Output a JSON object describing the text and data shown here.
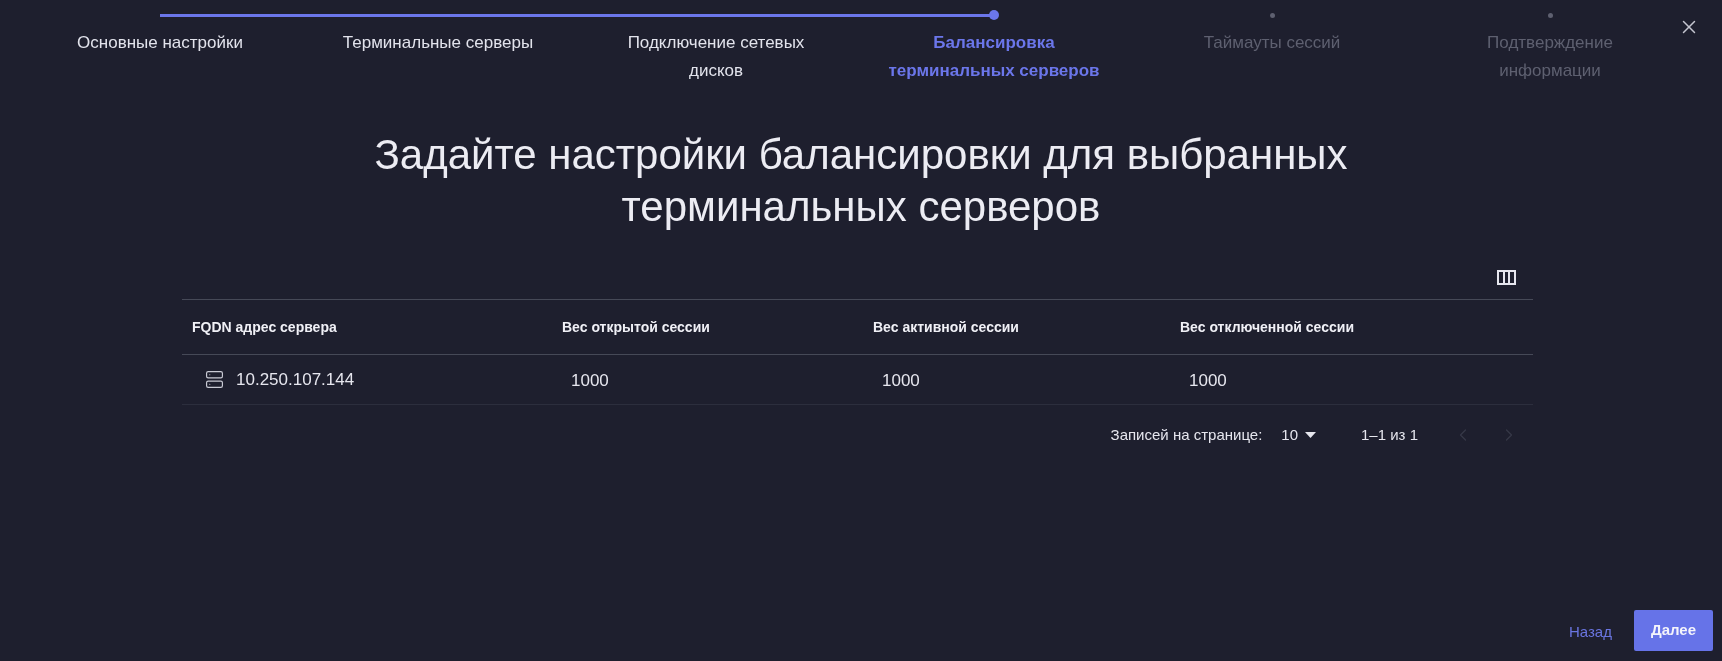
{
  "stepper": {
    "steps": [
      {
        "label": "Основные настройки",
        "completed": true,
        "selected": false
      },
      {
        "label": "Терминальные серверы",
        "completed": true,
        "selected": false
      },
      {
        "label": "Подключение сетевых дисков",
        "completed": true,
        "selected": false
      },
      {
        "label": "Балансировка терминальных серверов",
        "completed": false,
        "selected": true
      },
      {
        "label": "Таймауты сессий",
        "completed": false,
        "selected": false
      },
      {
        "label": "Подтверждение информации",
        "completed": false,
        "selected": false
      }
    ]
  },
  "title": "Задайте настройки балансировки для выбранных терминальных серверов",
  "table": {
    "columns": [
      "FQDN адрес сервера",
      "Вес открытой сессии",
      "Вес активной сессии",
      "Вес отключенной сессии"
    ],
    "rows": [
      {
        "cells": [
          "10.250.107.144",
          "1000",
          "1000",
          "1000"
        ]
      }
    ]
  },
  "pagination": {
    "rows_per_page_label": "Записей на странице:",
    "rows_per_page": "10",
    "range": "1–1 из 1",
    "prev_disabled": true,
    "next_disabled": true
  },
  "buttons": [
    {
      "label": "Назад",
      "kind": "text"
    },
    {
      "label": "Далее",
      "kind": "primary"
    }
  ]
}
